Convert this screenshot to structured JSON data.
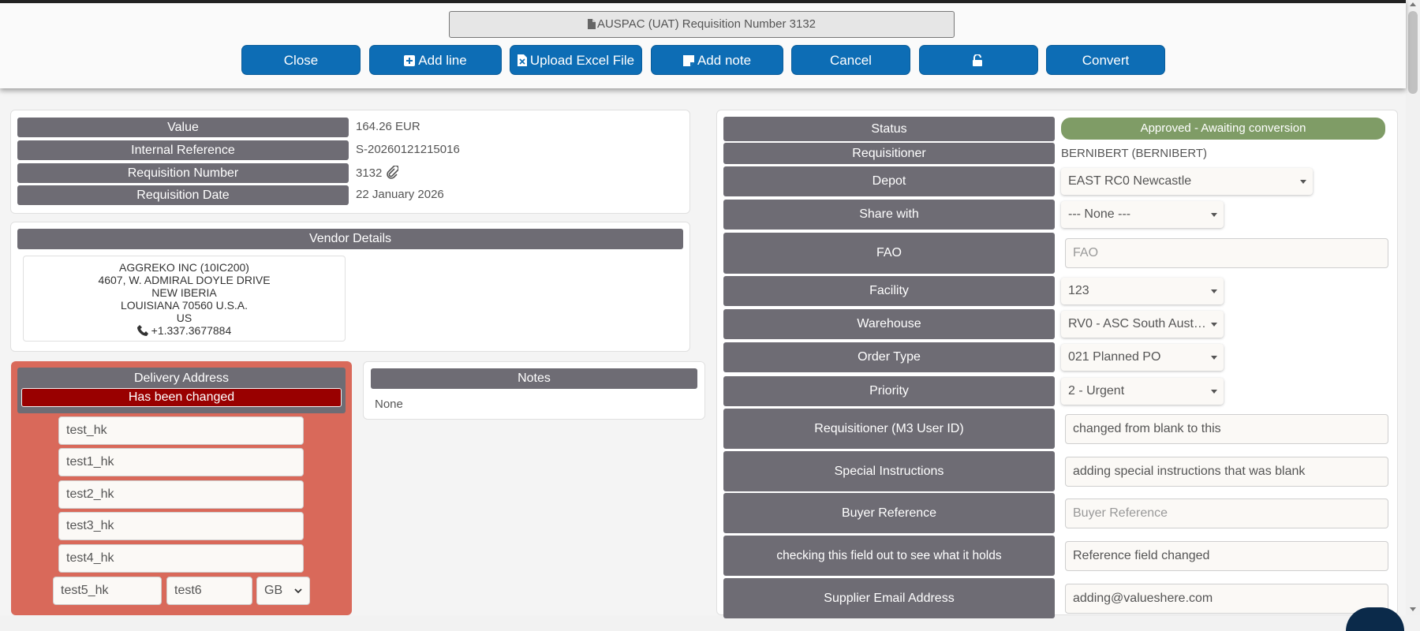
{
  "header": {
    "title": "AUSPAC (UAT) Requisition Number 3132",
    "buttons": {
      "close": "Close",
      "add_line": "Add line",
      "upload_excel": "Upload Excel File",
      "add_note": "Add note",
      "cancel": "Cancel",
      "convert": "Convert"
    }
  },
  "summary": {
    "value_label": "Value",
    "value": "164.26 EUR",
    "internal_ref_label": "Internal Reference",
    "internal_ref": "S-20260121215016",
    "req_number_label": "Requisition Number",
    "req_number": "3132",
    "req_date_label": "Requisition Date",
    "req_date": "22 January 2026"
  },
  "vendor": {
    "heading": "Vendor Details",
    "lines": [
      "AGGREKO INC (10IC200)",
      "4607, W. ADMIRAL DOYLE DRIVE",
      "NEW IBERIA",
      "LOUISIANA 70560 U.S.A.",
      "US"
    ],
    "phone": "+1.337.3677884"
  },
  "delivery": {
    "heading": "Delivery Address",
    "changed_badge": "Has been changed",
    "fields": [
      "test_hk",
      "test1_hk",
      "test2_hk",
      "test3_hk",
      "test4_hk"
    ],
    "field5": "test5_hk",
    "field6": "test6",
    "country": "GB",
    "panel_color": "#d9695a"
  },
  "notes": {
    "heading": "Notes",
    "text": "None"
  },
  "details": {
    "status_label": "Status",
    "status": "Approved - Awaiting conversion",
    "status_color": "#7f9c66",
    "requisitioner_label": "Requisitioner",
    "requisitioner": "BERNIBERT (BERNIBERT)",
    "depot_label": "Depot",
    "depot": "EAST RC0 Newcastle",
    "share_label": "Share with",
    "share": "--- None ---",
    "fao_label": "FAO",
    "fao_placeholder": "FAO",
    "facility_label": "Facility",
    "facility": "123",
    "warehouse_label": "Warehouse",
    "warehouse": "RV0 - ASC South Aust…",
    "order_type_label": "Order Type",
    "order_type": "021 Planned PO",
    "priority_label": "Priority",
    "priority": "2 - Urgent",
    "m3_user_label": "Requisitioner (M3 User ID)",
    "m3_user": "changed from blank to this",
    "special_label": "Special Instructions",
    "special": "adding special instructions that was blank",
    "buyer_ref_label": "Buyer Reference",
    "buyer_ref_placeholder": "Buyer Reference",
    "checking_label": "checking this field out to see what it holds",
    "checking": "Reference field changed",
    "supplier_email_label": "Supplier Email Address",
    "supplier_email": "adding@valueshere.com"
  },
  "colors": {
    "accent": "#0d6db5",
    "label_bg": "#6e6c74",
    "changed": "#990000"
  }
}
